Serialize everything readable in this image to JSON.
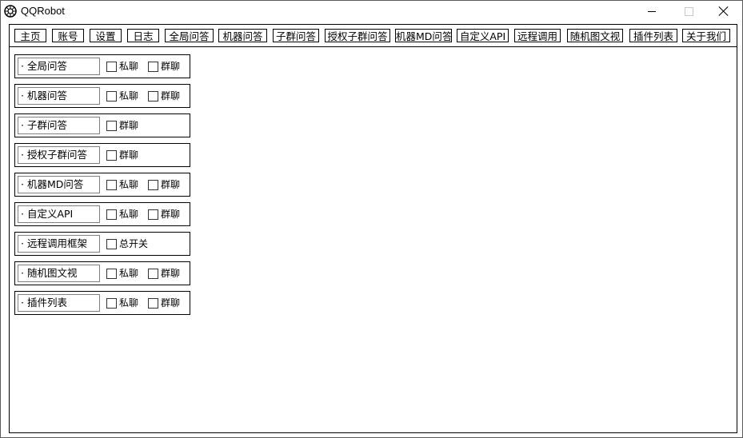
{
  "window": {
    "title": "QQRobot"
  },
  "tabs": [
    {
      "label": "主页"
    },
    {
      "label": "账号"
    },
    {
      "label": "设置"
    },
    {
      "label": "日志"
    },
    {
      "label": "全局问答"
    },
    {
      "label": "机器问答"
    },
    {
      "label": "子群问答"
    },
    {
      "label": "授权子群问答"
    },
    {
      "label": "机器MD问答"
    },
    {
      "label": "自定义API"
    },
    {
      "label": "远程调用"
    },
    {
      "label": "随机图文视"
    },
    {
      "label": "插件列表"
    },
    {
      "label": "关于我们"
    }
  ],
  "rows": [
    {
      "label": "· 全局问答",
      "options": [
        {
          "label": "私聊",
          "checked": false
        },
        {
          "label": "群聊",
          "checked": false
        }
      ]
    },
    {
      "label": "· 机器问答",
      "options": [
        {
          "label": "私聊",
          "checked": false
        },
        {
          "label": "群聊",
          "checked": false
        }
      ]
    },
    {
      "label": "· 子群问答",
      "options": [
        {
          "label": "群聊",
          "checked": false
        }
      ]
    },
    {
      "label": "· 授权子群问答",
      "options": [
        {
          "label": "群聊",
          "checked": false
        }
      ]
    },
    {
      "label": "· 机器MD问答",
      "options": [
        {
          "label": "私聊",
          "checked": false
        },
        {
          "label": "群聊",
          "checked": false
        }
      ]
    },
    {
      "label": "· 自定义API",
      "options": [
        {
          "label": "私聊",
          "checked": false
        },
        {
          "label": "群聊",
          "checked": false
        }
      ]
    },
    {
      "label": "· 远程调用框架",
      "options": [
        {
          "label": "总开关",
          "checked": false
        }
      ]
    },
    {
      "label": "· 随机图文视",
      "options": [
        {
          "label": "私聊",
          "checked": false
        },
        {
          "label": "群聊",
          "checked": false
        }
      ]
    },
    {
      "label": "· 插件列表",
      "options": [
        {
          "label": "私聊",
          "checked": false
        },
        {
          "label": "群聊",
          "checked": false
        }
      ]
    }
  ]
}
